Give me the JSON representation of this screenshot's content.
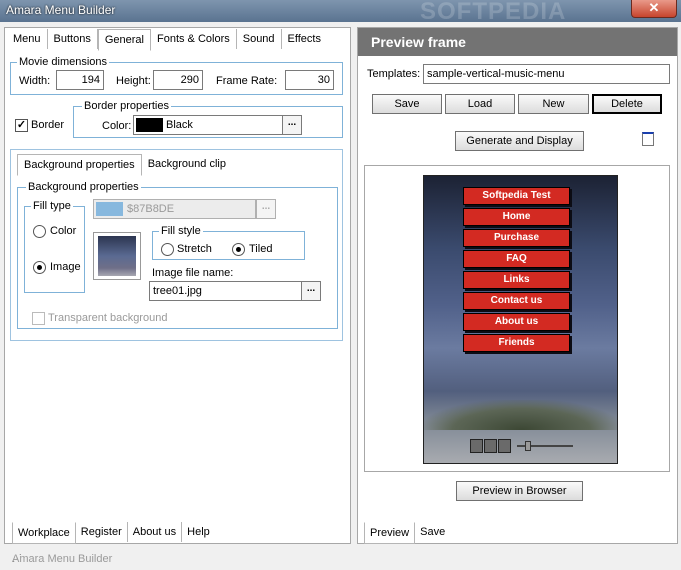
{
  "window": {
    "title": "Amara Menu Builder",
    "watermark": "SOFTPEDIA",
    "close_glyph": "✕"
  },
  "left": {
    "tabs": [
      "Menu",
      "Buttons",
      "General",
      "Fonts & Colors",
      "Sound",
      "Effects"
    ],
    "active_tab": "General",
    "movie_dimensions": {
      "legend": "Movie dimensions",
      "width_label": "Width:",
      "width_value": "194",
      "height_label": "Height:",
      "height_value": "290",
      "framerate_label": "Frame Rate:",
      "framerate_value": "30"
    },
    "border": {
      "checkbox_label": "Border",
      "checked": true,
      "legend": "Border properties",
      "color_label": "Color:",
      "color_value": "Black",
      "color_hex": "#000000",
      "dots": "..."
    },
    "bg_tabs": [
      "Background properties",
      "Background clip"
    ],
    "bg": {
      "legend": "Background properties",
      "filltype_legend": "Fill type",
      "color_option": "Color",
      "image_option": "Image",
      "selected": "Image",
      "color_value": "$87B8DE",
      "color_hex": "#87B8DE",
      "fillstyle_legend": "Fill style",
      "stretch_option": "Stretch",
      "tiled_option": "Tiled",
      "fillstyle_selected": "Tiled",
      "imagefile_label": "Image file name:",
      "imagefile_value": "tree01.jpg",
      "transparent_label": "Transparent background",
      "dots": "..."
    },
    "bottom_tabs": [
      "Workplace",
      "Register",
      "About us",
      "Help"
    ],
    "active_bottom_tab": "Workplace"
  },
  "right": {
    "header": "Preview frame",
    "templates_label": "Templates:",
    "templates_value": "sample-vertical-music-menu",
    "buttons": {
      "save": "Save",
      "load": "Load",
      "new": "New",
      "delete": "Delete"
    },
    "generate_label": "Generate and Display",
    "menu_items": [
      "Softpedia Test",
      "Home",
      "Purchase",
      "FAQ",
      "Links",
      "Contact us",
      "About us",
      "Friends"
    ],
    "menu_color": "#D32A22",
    "preview_browser_label": "Preview in Browser",
    "bottom_tabs": [
      "Preview",
      "Save"
    ],
    "active_bottom_tab": "Preview"
  },
  "status": {
    "text": "Amara Menu Builder"
  }
}
